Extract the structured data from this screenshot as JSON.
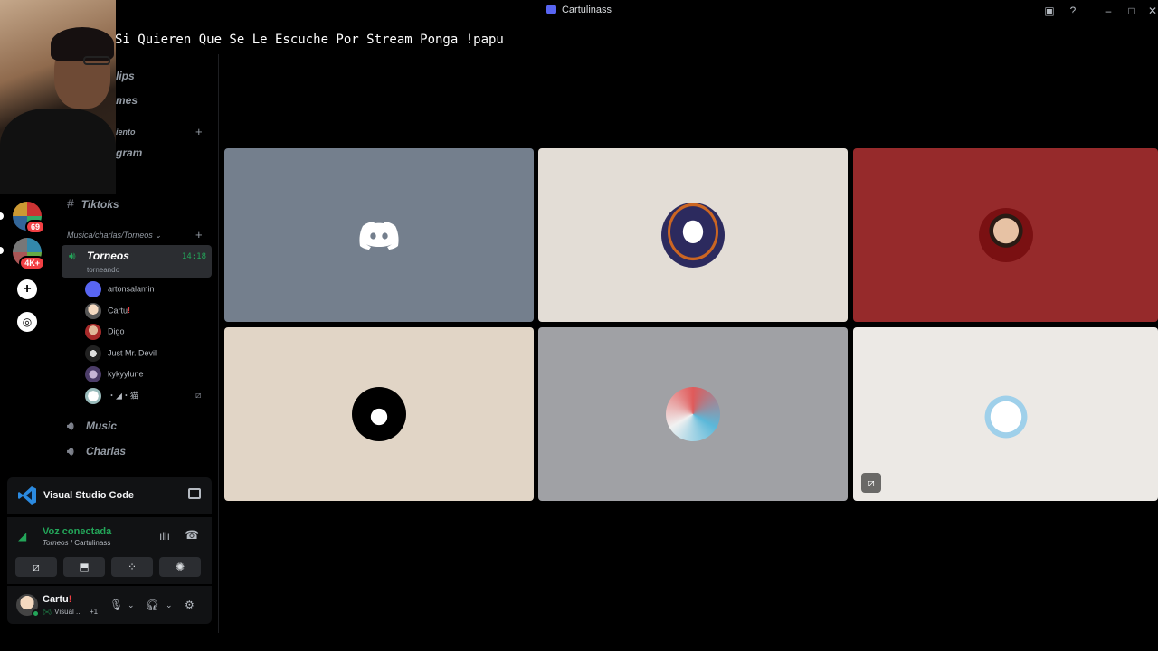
{
  "window": {
    "title": "Cartulinass"
  },
  "overlay": {
    "banner": "Si Quieren Que Se Le Escuche Por Stream Ponga !papu"
  },
  "sidebar": {
    "faded_items": [
      "lips",
      "mes",
      "iento",
      "gram"
    ],
    "text_channel": "Tiktoks",
    "category": "Musica/charlas/Torneos",
    "active_voice": {
      "name": "Torneos",
      "status": "torneando",
      "timer": "14:18"
    },
    "voice_users": [
      {
        "name": "artonsalamin",
        "flag": ""
      },
      {
        "name": "Cartu",
        "flag": "!"
      },
      {
        "name": "Digo",
        "flag": ""
      },
      {
        "name": "Just Mr. Devil",
        "flag": ""
      },
      {
        "name": "kykyylune",
        "flag": ""
      },
      {
        "name": "・◢・猫",
        "flag": ""
      }
    ],
    "voice_channels": [
      "Music",
      "Charlas"
    ]
  },
  "servers": {
    "badges": [
      "69",
      "4K+"
    ]
  },
  "activity": {
    "app_label": "Visual Studio Code"
  },
  "voice_panel": {
    "status": "Voz conectada",
    "channel": "Torneos",
    "server": "Cartulinass"
  },
  "user_panel": {
    "name": "Cartu",
    "name_flag": "!",
    "status": "Visual ...",
    "extra": "+1"
  },
  "tiles": [
    {
      "bg": "#747f8d",
      "avatar": "discord-default-icon"
    },
    {
      "bg": "#e3ddd6",
      "avatar": "penguin-avatar"
    },
    {
      "bg": "#962a2b",
      "avatar": "person-avatar"
    },
    {
      "bg": "#e1d5c6",
      "avatar": "black-cat-avatar"
    },
    {
      "bg": "#a0a1a5",
      "avatar": "creature-avatar"
    },
    {
      "bg": "#ece9e5",
      "avatar": "bunny-avatar",
      "muted": true
    }
  ],
  "colors": {
    "accent": "#5865f2",
    "connected": "#23a559",
    "danger": "#f23f43"
  }
}
